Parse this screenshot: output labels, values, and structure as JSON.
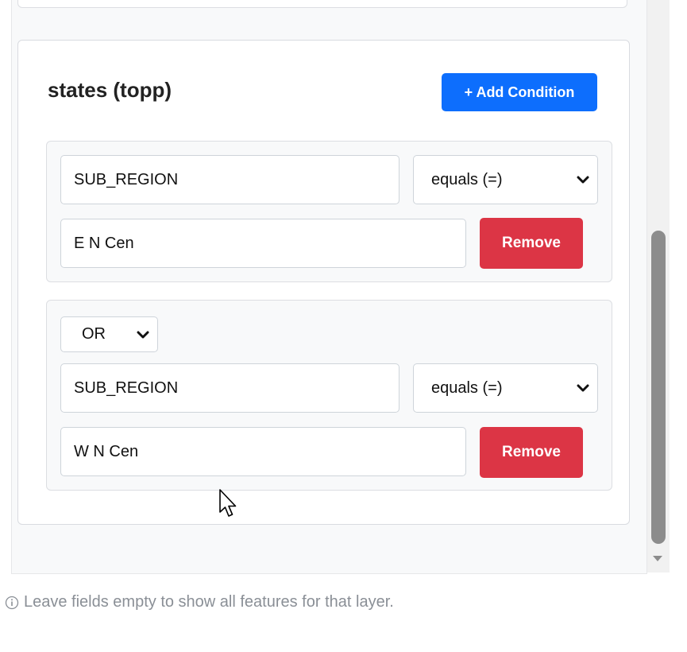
{
  "layer": {
    "title": "states (topp)",
    "add_condition_label": "+ Add Condition"
  },
  "conditions": [
    {
      "field_value": "SUB_REGION",
      "operator": "equals (=)",
      "value": "E N Cen",
      "remove_label": "Remove"
    },
    {
      "logic": "OR",
      "field_value": "SUB_REGION",
      "operator": "equals (=)",
      "value": "W N Cen",
      "remove_label": "Remove"
    }
  ],
  "hint": "Leave fields empty to show all features for that layer.",
  "icons": {
    "info": "info-icon",
    "chevron": "chevron-down-icon",
    "cursor": "mouse-pointer-icon"
  },
  "colors": {
    "primary": "#0d6efd",
    "danger": "#dc3545"
  }
}
